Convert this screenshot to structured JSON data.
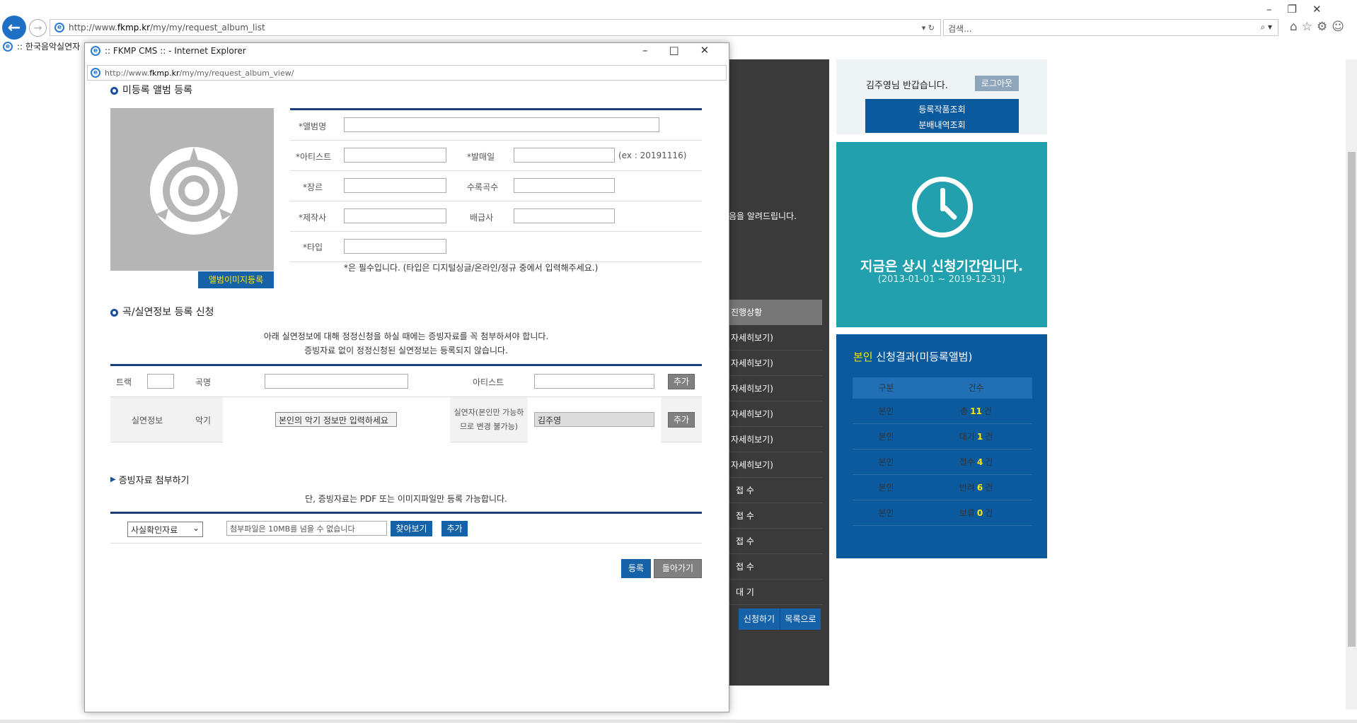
{
  "browser": {
    "url_prefix": "http://www.",
    "url_domain": "fkmp.kr",
    "url_path": "/my/my/request_album_list",
    "search_placeholder": "검색...",
    "tab_title": ":: 한국음악실연자"
  },
  "bg": {
    "notice": "음을 알려드립니다.",
    "status_header": "진행상황",
    "rows": [
      "자세히보기)",
      "자세히보기)",
      "자세히보기)",
      "자세히보기)",
      "자세히보기)",
      "자세히보기)",
      "접 수",
      "접 수",
      "접 수",
      "접 수",
      "대 기"
    ],
    "btn_apply": "신청하기",
    "btn_list": "목록으로",
    "greeting": "김주영님 반갑습니다.",
    "logout": "로그아웃",
    "menu1": "등록작품조회",
    "menu2": "분배내역조회",
    "period_title": "지금은 상시 신청기간입니다.",
    "period_dates": "(2013-01-01 ~ 2019-12-31)",
    "result_title_hl": "본인",
    "result_title": "신청결과(미등록앨범)",
    "result_head": [
      "구분",
      "건수"
    ],
    "result_rows": [
      {
        "who": "본인",
        "pre": "총",
        "n": "11",
        "suf": "건"
      },
      {
        "who": "본인",
        "pre": "대기",
        "n": "1",
        "suf": "건"
      },
      {
        "who": "본인",
        "pre": "접수",
        "n": "4",
        "suf": "건"
      },
      {
        "who": "본인",
        "pre": "반려",
        "n": "6",
        "suf": "건"
      },
      {
        "who": "본인",
        "pre": "보류",
        "n": "0",
        "suf": "건"
      }
    ],
    "colors": {
      "accent_blue": "#0b5a9e",
      "teal": "#23a0ad",
      "highlight": "#ffe600"
    }
  },
  "popup": {
    "title": ":: FKMP CMS :: - Internet Explorer",
    "url_prefix": "http://www.",
    "url_domain": "fkmp.kr",
    "url_path": "/my/my/request_album_view/",
    "section1": "미등록 앨범 등록",
    "img_button": "앨범이미지등록",
    "labels": {
      "album": "*앨범명",
      "artist": "*아티스트",
      "release": "*발매일",
      "genre": "*장르",
      "tracks": "수록곡수",
      "producer": "*제작사",
      "distributor": "배급사",
      "type": "*타입"
    },
    "date_hint": "(ex : 20191116)",
    "required_note": "*은 필수입니다. (타입은 디지털싱글/온라인/정규 중에서 입력해주세요.)",
    "section2": "곡/실연정보 등록 신청",
    "notice1": "아래 실연정보에 대해 정정신청을 하실 때에는 증빙자료를 꼭 첨부하셔야 합니다.",
    "notice2": "증빙자료 없이 정정신청된 실연정보는 등록되지 않습니다.",
    "track_label": "트랙",
    "song_label": "곡명",
    "artist_label": "아티스트",
    "add": "추가",
    "perf_label": "실연정보",
    "instr_label": "악기",
    "instr_value": "본인의 악기 정보만 입력하세요",
    "performer_label1": "실연자(본인만 가능하",
    "performer_label2": "므로 변경 불가능)",
    "performer_value": "김주영",
    "section3": "증빙자료 첨부하기",
    "notice3": "단, 증빙자료는 PDF 또는 이미지파일만 등록 가능합니다.",
    "doc_select": "사실확인자료",
    "file_placeholder": "첨부파일은 10MB를 넘을 수 없습니다",
    "browse": "찾아보기",
    "add2": "추가",
    "submit": "등록",
    "back": "돌아가기"
  }
}
